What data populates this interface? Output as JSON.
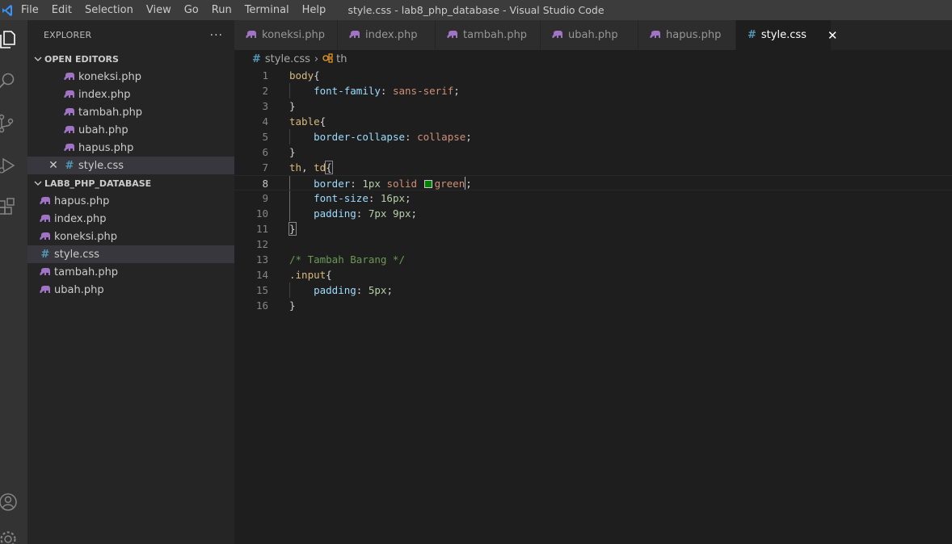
{
  "titlebar": {
    "menu": [
      "File",
      "Edit",
      "Selection",
      "View",
      "Go",
      "Run",
      "Terminal",
      "Help"
    ],
    "window_title": "style.css - lab8_php_database - Visual Studio Code"
  },
  "sidebar": {
    "header": "EXPLORER",
    "more": "···",
    "open_editors_title": "OPEN EDITORS",
    "open_editors": [
      {
        "name": "koneksi.php",
        "type": "php"
      },
      {
        "name": "index.php",
        "type": "php"
      },
      {
        "name": "tambah.php",
        "type": "php"
      },
      {
        "name": "ubah.php",
        "type": "php"
      },
      {
        "name": "hapus.php",
        "type": "php"
      },
      {
        "name": "style.css",
        "type": "css",
        "active": true
      }
    ],
    "project_title": "LAB8_PHP_DATABASE",
    "files": [
      {
        "name": "hapus.php",
        "type": "php"
      },
      {
        "name": "index.php",
        "type": "php"
      },
      {
        "name": "koneksi.php",
        "type": "php"
      },
      {
        "name": "style.css",
        "type": "css",
        "selected": true
      },
      {
        "name": "tambah.php",
        "type": "php"
      },
      {
        "name": "ubah.php",
        "type": "php"
      }
    ]
  },
  "tabs": [
    {
      "label": "koneksi.php",
      "type": "php"
    },
    {
      "label": "index.php",
      "type": "php"
    },
    {
      "label": "tambah.php",
      "type": "php"
    },
    {
      "label": "ubah.php",
      "type": "php"
    },
    {
      "label": "hapus.php",
      "type": "php"
    },
    {
      "label": "style.css",
      "type": "css",
      "active": true
    }
  ],
  "breadcrumb": {
    "file": "style.css",
    "symbol": "th"
  },
  "editor": {
    "current_line": 8,
    "lines": [
      {
        "n": "1",
        "text": "body{"
      },
      {
        "n": "2",
        "text": "    font-family: sans-serif;"
      },
      {
        "n": "3",
        "text": "}"
      },
      {
        "n": "4",
        "text": "table{"
      },
      {
        "n": "5",
        "text": "    border-collapse: collapse;"
      },
      {
        "n": "6",
        "text": "}"
      },
      {
        "n": "7",
        "text": "th, td{"
      },
      {
        "n": "8",
        "text": "    border: 1px solid green;"
      },
      {
        "n": "9",
        "text": "    font-size: 16px;"
      },
      {
        "n": "10",
        "text": "    padding: 7px 9px;"
      },
      {
        "n": "11",
        "text": "}"
      },
      {
        "n": "12",
        "text": ""
      },
      {
        "n": "13",
        "text": "/* Tambah Barang */"
      },
      {
        "n": "14",
        "text": ".input{"
      },
      {
        "n": "15",
        "text": "    padding: 5px;"
      },
      {
        "n": "16",
        "text": "}"
      }
    ]
  },
  "colors": {
    "php_icon": "#a074c4",
    "css_icon": "#519aba",
    "swatch_green": "#008000"
  },
  "icons": {
    "activity": [
      "files-icon",
      "search-icon",
      "source-control-icon",
      "run-debug-icon",
      "extensions-icon",
      "account-icon",
      "settings-gear-icon"
    ]
  }
}
